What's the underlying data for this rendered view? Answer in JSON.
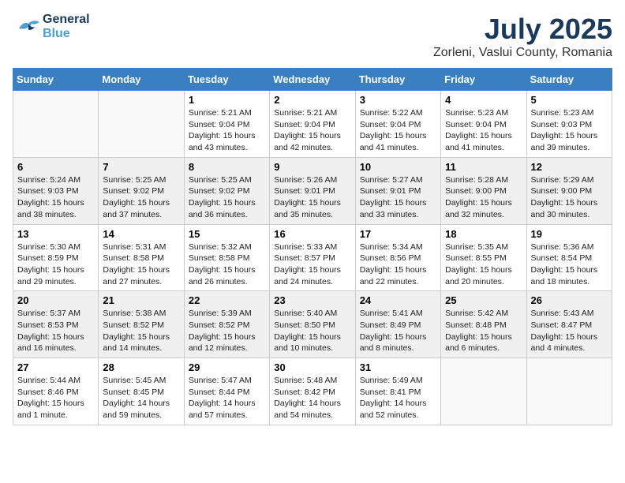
{
  "header": {
    "logo_general": "General",
    "logo_blue": "Blue",
    "month": "July 2025",
    "location": "Zorleni, Vaslui County, Romania"
  },
  "weekdays": [
    "Sunday",
    "Monday",
    "Tuesday",
    "Wednesday",
    "Thursday",
    "Friday",
    "Saturday"
  ],
  "weeks": [
    [
      {
        "day": "",
        "info": ""
      },
      {
        "day": "",
        "info": ""
      },
      {
        "day": "1",
        "info": "Sunrise: 5:21 AM\nSunset: 9:04 PM\nDaylight: 15 hours\nand 43 minutes."
      },
      {
        "day": "2",
        "info": "Sunrise: 5:21 AM\nSunset: 9:04 PM\nDaylight: 15 hours\nand 42 minutes."
      },
      {
        "day": "3",
        "info": "Sunrise: 5:22 AM\nSunset: 9:04 PM\nDaylight: 15 hours\nand 41 minutes."
      },
      {
        "day": "4",
        "info": "Sunrise: 5:23 AM\nSunset: 9:04 PM\nDaylight: 15 hours\nand 41 minutes."
      },
      {
        "day": "5",
        "info": "Sunrise: 5:23 AM\nSunset: 9:03 PM\nDaylight: 15 hours\nand 39 minutes."
      }
    ],
    [
      {
        "day": "6",
        "info": "Sunrise: 5:24 AM\nSunset: 9:03 PM\nDaylight: 15 hours\nand 38 minutes."
      },
      {
        "day": "7",
        "info": "Sunrise: 5:25 AM\nSunset: 9:02 PM\nDaylight: 15 hours\nand 37 minutes."
      },
      {
        "day": "8",
        "info": "Sunrise: 5:25 AM\nSunset: 9:02 PM\nDaylight: 15 hours\nand 36 minutes."
      },
      {
        "day": "9",
        "info": "Sunrise: 5:26 AM\nSunset: 9:01 PM\nDaylight: 15 hours\nand 35 minutes."
      },
      {
        "day": "10",
        "info": "Sunrise: 5:27 AM\nSunset: 9:01 PM\nDaylight: 15 hours\nand 33 minutes."
      },
      {
        "day": "11",
        "info": "Sunrise: 5:28 AM\nSunset: 9:00 PM\nDaylight: 15 hours\nand 32 minutes."
      },
      {
        "day": "12",
        "info": "Sunrise: 5:29 AM\nSunset: 9:00 PM\nDaylight: 15 hours\nand 30 minutes."
      }
    ],
    [
      {
        "day": "13",
        "info": "Sunrise: 5:30 AM\nSunset: 8:59 PM\nDaylight: 15 hours\nand 29 minutes."
      },
      {
        "day": "14",
        "info": "Sunrise: 5:31 AM\nSunset: 8:58 PM\nDaylight: 15 hours\nand 27 minutes."
      },
      {
        "day": "15",
        "info": "Sunrise: 5:32 AM\nSunset: 8:58 PM\nDaylight: 15 hours\nand 26 minutes."
      },
      {
        "day": "16",
        "info": "Sunrise: 5:33 AM\nSunset: 8:57 PM\nDaylight: 15 hours\nand 24 minutes."
      },
      {
        "day": "17",
        "info": "Sunrise: 5:34 AM\nSunset: 8:56 PM\nDaylight: 15 hours\nand 22 minutes."
      },
      {
        "day": "18",
        "info": "Sunrise: 5:35 AM\nSunset: 8:55 PM\nDaylight: 15 hours\nand 20 minutes."
      },
      {
        "day": "19",
        "info": "Sunrise: 5:36 AM\nSunset: 8:54 PM\nDaylight: 15 hours\nand 18 minutes."
      }
    ],
    [
      {
        "day": "20",
        "info": "Sunrise: 5:37 AM\nSunset: 8:53 PM\nDaylight: 15 hours\nand 16 minutes."
      },
      {
        "day": "21",
        "info": "Sunrise: 5:38 AM\nSunset: 8:52 PM\nDaylight: 15 hours\nand 14 minutes."
      },
      {
        "day": "22",
        "info": "Sunrise: 5:39 AM\nSunset: 8:52 PM\nDaylight: 15 hours\nand 12 minutes."
      },
      {
        "day": "23",
        "info": "Sunrise: 5:40 AM\nSunset: 8:50 PM\nDaylight: 15 hours\nand 10 minutes."
      },
      {
        "day": "24",
        "info": "Sunrise: 5:41 AM\nSunset: 8:49 PM\nDaylight: 15 hours\nand 8 minutes."
      },
      {
        "day": "25",
        "info": "Sunrise: 5:42 AM\nSunset: 8:48 PM\nDaylight: 15 hours\nand 6 minutes."
      },
      {
        "day": "26",
        "info": "Sunrise: 5:43 AM\nSunset: 8:47 PM\nDaylight: 15 hours\nand 4 minutes."
      }
    ],
    [
      {
        "day": "27",
        "info": "Sunrise: 5:44 AM\nSunset: 8:46 PM\nDaylight: 15 hours\nand 1 minute."
      },
      {
        "day": "28",
        "info": "Sunrise: 5:45 AM\nSunset: 8:45 PM\nDaylight: 14 hours\nand 59 minutes."
      },
      {
        "day": "29",
        "info": "Sunrise: 5:47 AM\nSunset: 8:44 PM\nDaylight: 14 hours\nand 57 minutes."
      },
      {
        "day": "30",
        "info": "Sunrise: 5:48 AM\nSunset: 8:42 PM\nDaylight: 14 hours\nand 54 minutes."
      },
      {
        "day": "31",
        "info": "Sunrise: 5:49 AM\nSunset: 8:41 PM\nDaylight: 14 hours\nand 52 minutes."
      },
      {
        "day": "",
        "info": ""
      },
      {
        "day": "",
        "info": ""
      }
    ]
  ]
}
